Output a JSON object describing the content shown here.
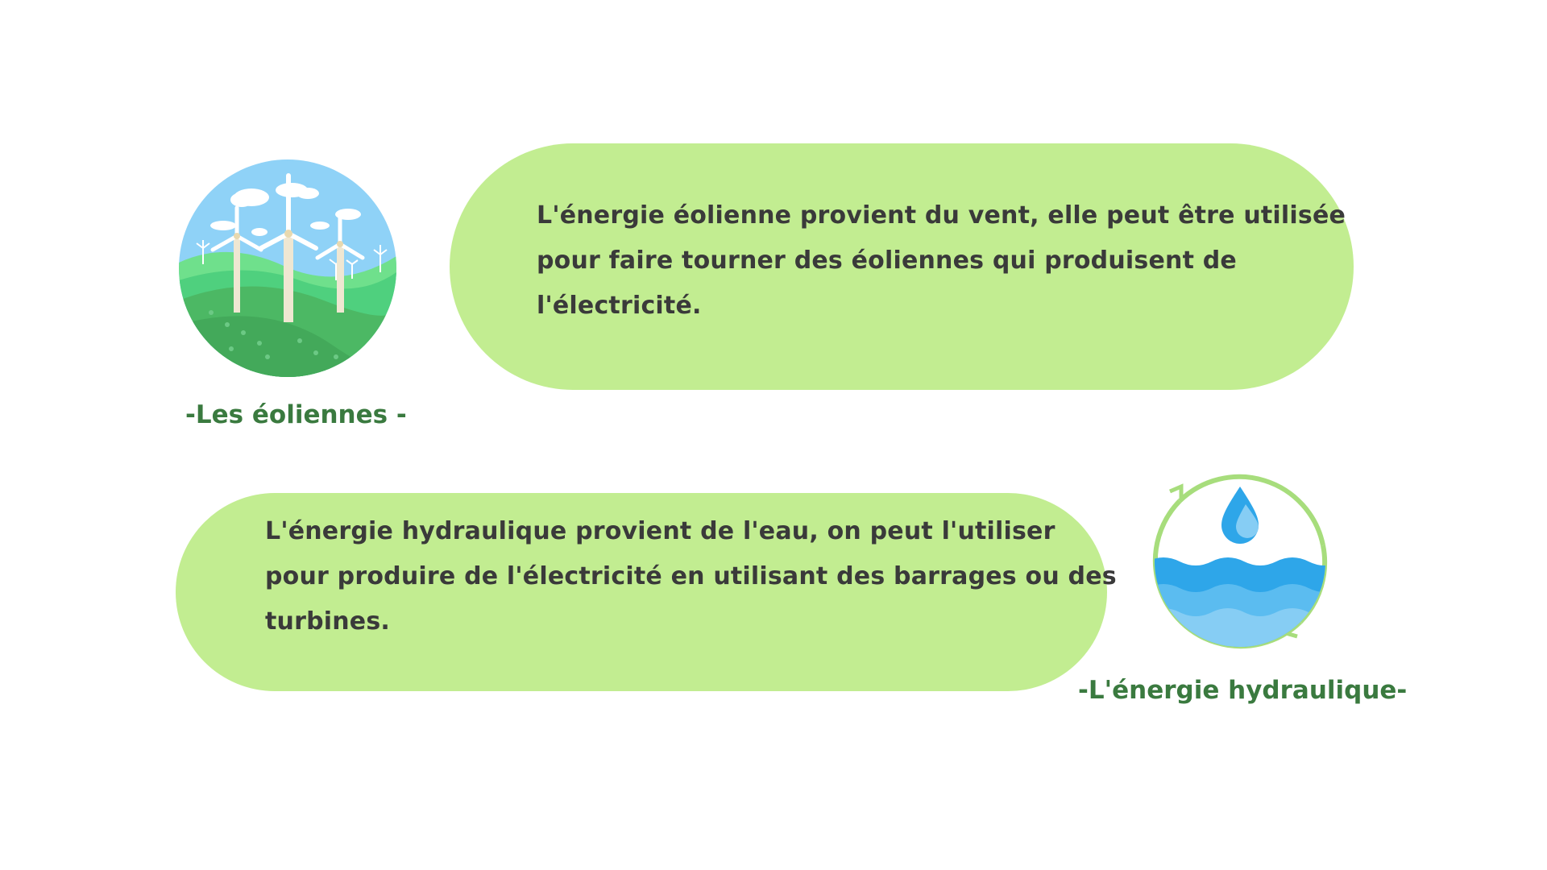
{
  "colors": {
    "bubble": "#c2ed91",
    "caption": "#3a7a3f",
    "text": "#3a3a3a",
    "water": "#2ea6e9",
    "ring": "#a7dd7c"
  },
  "wind": {
    "icon": "wind-turbines-illustration",
    "caption": "-Les éoliennes -",
    "lines": [
      "L'énergie éolienne provient du vent, elle peut être utilisée",
      "pour faire tourner des éoliennes qui produisent de",
      "l'électricité."
    ]
  },
  "hydro": {
    "icon": "water-drop-waves-illustration",
    "caption": "-L'énergie hydraulique-",
    "lines": [
      "L'énergie hydraulique provient de l'eau, on peut l'utiliser",
      "pour produire de l'électricité en utilisant des barrages ou des",
      "turbines."
    ]
  }
}
